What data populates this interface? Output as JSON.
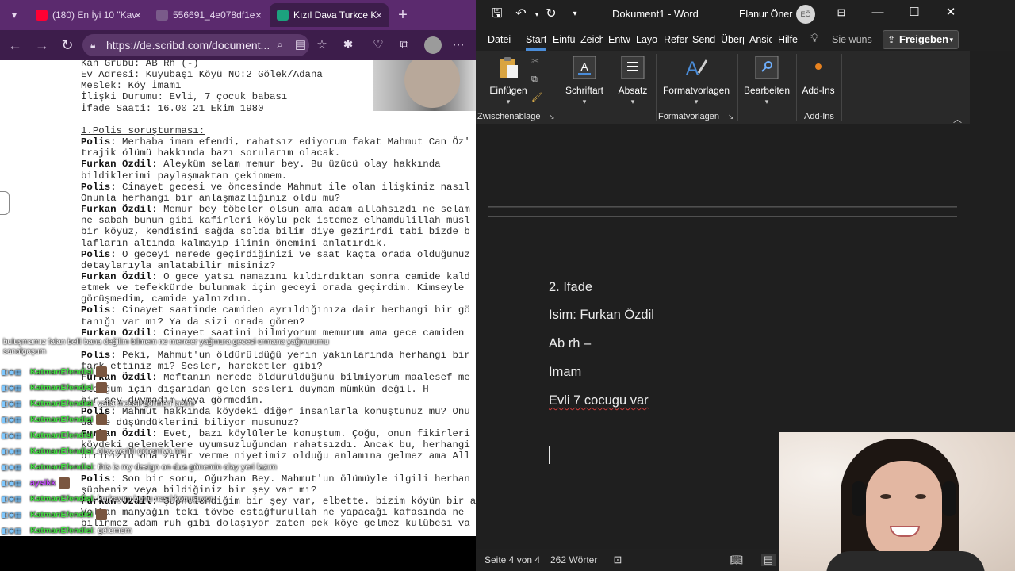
{
  "browser": {
    "tabs": [
      {
        "label": "(180) En İyi 10 \"Kav",
        "favicon_color": "#ff0033"
      },
      {
        "label": "556691_4e078df1e",
        "favicon_color": "#7a5b8a"
      },
      {
        "label": "Kızıl Dava Turkce K",
        "favicon_color": "#1ca27e"
      }
    ],
    "url": "https://de.scribd.com/document..."
  },
  "document": {
    "lines": [
      "Kan Grubu: AB Rh (-)",
      "Ev Adresi: Kuyubaşı Köyü NO:2 Gölek/Adana",
      "Meslek: Köy İmamı",
      "İlişki Durumu: Evli, 7 çocuk babası",
      "İfade Saati: 16.00 21 Ekim 1980",
      "",
      "1.Polis soruşturması:",
      "Polis: Merhaba imam efendi, rahatsız ediyorum fakat Mahmut Can Öz'",
      "trajik ölümü hakkında bazı sorularım olacak.",
      "Furkan Özdil: Aleyküm selam memur bey. Bu üzücü olay hakkında",
      "bildiklerimi paylaşmaktan çekinmem.",
      "Polis: Cinayet gecesi ve öncesinde Mahmut ile olan ilişkiniz nasıl",
      "Onunla herhangi bir anlaşmazlığınız oldu mu?",
      "Furkan Özdil: Memur bey töbeler olsun ama adam allahsızdı ne selam",
      "ne sabah bunun gibi kafirleri köylü pek istemez elhamdulillah müsl",
      "bir köyüz, kendisini sağda solda bilim diye gezirirdi tabi bizde b",
      "lafların altında kalmayıp ilimin önemini anlatırdık.",
      "Polis: O geceyi nerede geçirdiğinizi ve saat kaçta orada olduğunuz",
      "detaylarıyla anlatabilir misiniz?",
      "Furkan Özdil: O gece yatsı namazını kıldırdıktan sonra camide kald",
      "etmek ve tefekkürde bulunmak için geceyi orada geçirdim. Kimseyle",
      "görüşmedim, camide yalnızdım.",
      "Polis: Cinayet saatinde camiden ayrıldığınıza dair herhangi bir gö",
      "tanığı var mı? Ya da sizi orada gören?",
      "Furkan Özdil: Cinayet saatini bilmiyorum memurum ama gece camiden",
      "",
      "Polis: Peki, Mahmut'un öldürüldüğü yerin yakınlarında herhangi bir",
      "fark ettiniz mi? Sesler, hareketler gibi?",
      "Furkan Özdil: Meftanın nerede öldürüldüğünü bilmiyorum maalesef me",
      "olduğum için dışarıdan gelen sesleri duymam mümkün değil. H",
      "bir şey duymadım veya görmedim.",
      "Polis: Mahmut hakkında köydeki diğer insanlarla konuştunuz mu? Onu",
      "da ne düşündüklerini biliyor musunuz?",
      "Furkan Özdil: Evet, bazı köylülerle konuştum. Çoğu, onun fikirleri",
      "köydeki geleneklere uyumsuzluğundan rahatsızdı. Ancak bu, herhangi",
      "birinizin ona zarar verme niyetimiz olduğu anlamına gelmez ama All",
      "",
      "Polis: Son bir soru, Oğuzhan Bey. Mahmut'un ölümüyle ilgili herhan",
      "şüpheniz veya bildiğiniz bir şey var mı?",
      "Furkan Özdil: Şüphelendiğim bir şey var, elbette. bizim köyün bir avcısı var",
      "Volkan manyağın teki tövbe estağfurullah ne yapacağı kafasında ne",
      "bilinmez adam ruh gibi dolaşıyor zaten pek köye gelmez kulübesi va"
    ]
  },
  "chat": {
    "top_text": "buluşmamız falan belli bana değilim bilmem ne merreer yağmura gecesi ormana yağmurumu sanalgaşum",
    "messages": [
      {
        "user": "KatmanEfendisi",
        "msg": ""
      },
      {
        "user": "KatmanEfendisi",
        "msg": ""
      },
      {
        "user": "KatmanEfendisi",
        "msg": ": valla mesali görmen lazım"
      },
      {
        "user": "KatmanEfendisi",
        "msg": ""
      },
      {
        "user": "KatmanEfendisi",
        "msg": ""
      },
      {
        "user": "KatmanEfendisi",
        "msg": ": olay yerini göremiyo mu"
      },
      {
        "user": "KatmanEfendisi",
        "msg": ": this is my design on dua gönemin olay yeri lazım"
      },
      {
        "user": "aysikk",
        "msg": ""
      },
      {
        "user": "KatmanEfendisi",
        "msg": ": kurkayım bunu nasıl konuşuyor"
      },
      {
        "user": "KatmanEfendisi",
        "msg": ""
      },
      {
        "user": "KatmanEfendisi",
        "msg": ": gelemem"
      },
      {
        "user": "KatmanEfendisi",
        "msg": ": siparis bekliim"
      },
      {
        "user": "KatmanEfendisi",
        "msg": ": 7 cocuk ne mksjsjjs"
      }
    ]
  },
  "word": {
    "title": "Dokument1  -  Word",
    "user_name": "Elanur Öner",
    "user_initials": "EÖ",
    "tabs": [
      "Datei",
      "Start",
      "Einfü",
      "Zeich",
      "Entw",
      "Layo",
      "Refer",
      "Send",
      "Überp",
      "Ansic",
      "Hilfe"
    ],
    "active_tab": "Start",
    "tell_me": "Sie wüns",
    "share": "Freigeben",
    "ribbon": {
      "paste": "Einfügen",
      "clipboard_group": "Zwischenablage",
      "font": "Schriftart",
      "paragraph": "Absatz",
      "styles": "Formatvorlagen",
      "styles_group": "Formatvorlagen",
      "editing": "Bearbeiten",
      "addins": "Add-Ins",
      "addins_group": "Add-Ins"
    },
    "paragraphs": [
      "2. Ifade",
      "Isim: Furkan Özdil",
      "Ab rh –",
      "Imam",
      "Evli 7 cocugu var"
    ],
    "status": {
      "page": "Seite 4 von 4",
      "words": "262 Wörter"
    },
    "colors": {
      "accent": "#4a8cd8",
      "ribbon_bg": "#292929",
      "canvas_bg": "#1f1f1f"
    }
  }
}
